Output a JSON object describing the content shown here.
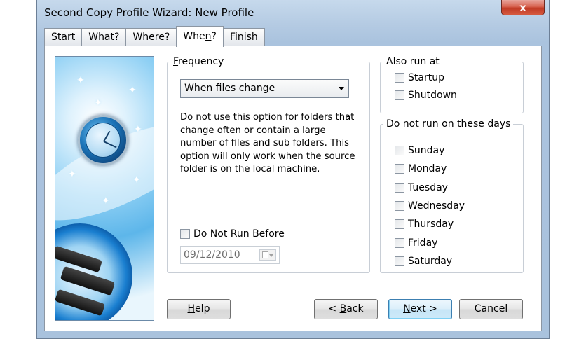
{
  "window": {
    "title": "Second Copy Profile Wizard: New Profile",
    "close_label": "x"
  },
  "tabs": [
    {
      "label_prefix": "",
      "label_accel": "S",
      "label_rest": "tart",
      "active": false
    },
    {
      "label_prefix": "",
      "label_accel": "W",
      "label_rest": "hat?",
      "active": false
    },
    {
      "label_prefix": "Wh",
      "label_accel": "e",
      "label_rest": "re?",
      "active": false
    },
    {
      "label_prefix": "Whe",
      "label_accel": "n",
      "label_rest": "?",
      "active": true
    },
    {
      "label_prefix": "",
      "label_accel": "F",
      "label_rest": "inish",
      "active": false
    }
  ],
  "frequency": {
    "legend_accel": "F",
    "legend_rest": "requency",
    "selected": "When files change",
    "description": "Do not use this option for folders that change often or contain a large number of files and sub folders. This option will only work when the source folder is on the local machine.",
    "do_not_run_before_label": "Do Not Run Before",
    "do_not_run_before_checked": false,
    "date_value": "09/12/2010"
  },
  "also_run_at": {
    "legend": "Also run at",
    "options": [
      {
        "label": "Startup",
        "checked": false
      },
      {
        "label": "Shutdown",
        "checked": false
      }
    ]
  },
  "do_not_run_days": {
    "legend": "Do not run on these days",
    "days": [
      {
        "label": "Sunday",
        "checked": false
      },
      {
        "label": "Monday",
        "checked": false
      },
      {
        "label": "Tuesday",
        "checked": false
      },
      {
        "label": "Wednesday",
        "checked": false
      },
      {
        "label": "Thursday",
        "checked": false
      },
      {
        "label": "Friday",
        "checked": false
      },
      {
        "label": "Saturday",
        "checked": false
      }
    ]
  },
  "buttons": {
    "help_accel": "H",
    "help_rest": "elp",
    "back_prefix": "< ",
    "back_accel": "B",
    "back_rest": "ack",
    "next_accel": "N",
    "next_rest": "ext >",
    "cancel": "Cancel"
  }
}
